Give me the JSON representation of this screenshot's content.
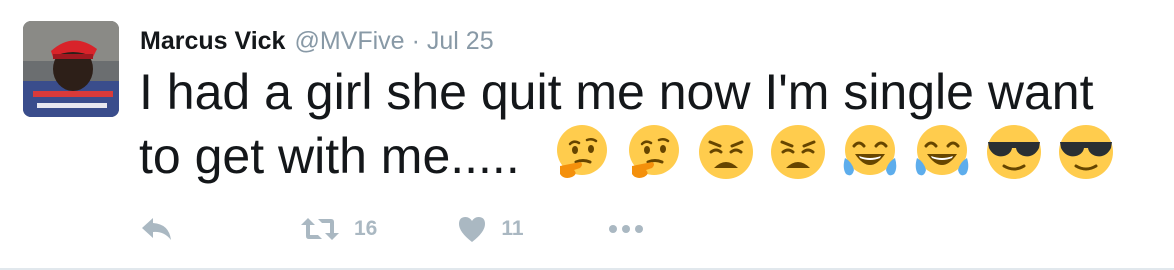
{
  "tweet": {
    "author_name": "Marcus Vick",
    "handle": "@MVFive",
    "separator": "·",
    "date": "Jul 25",
    "text": "I had a girl she quit me now I'm single want to get with me.....",
    "emojis": [
      "thinking-face",
      "thinking-face",
      "weary-face",
      "weary-face",
      "face-with-tears-of-joy",
      "face-with-tears-of-joy",
      "smiling-face-with-sunglasses",
      "smiling-face-with-sunglasses"
    ]
  },
  "actions": {
    "reply_icon": "reply-icon",
    "retweet_icon": "retweet-icon",
    "retweet_count": "16",
    "like_icon": "heart-icon",
    "like_count": "11",
    "more_icon": "more-icon"
  },
  "colors": {
    "text": "#14171a",
    "muted": "#8899a6",
    "action": "#aab8c2",
    "emoji_yellow": "#ffcc4d",
    "emoji_dark": "#664500",
    "tear_blue": "#5dadec",
    "hand_orange": "#f4900c"
  }
}
